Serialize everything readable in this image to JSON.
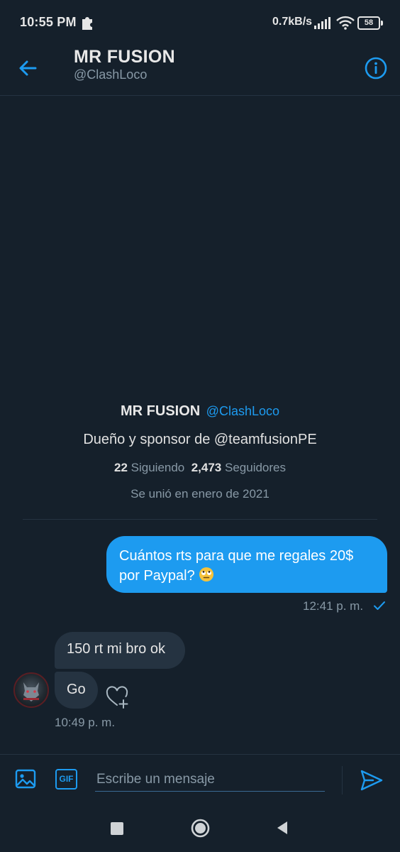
{
  "status_bar": {
    "time": "10:55 PM",
    "speed": "0.7kB/s",
    "battery": "58",
    "icons": [
      "puzzle-icon",
      "signal-icon",
      "wifi-icon",
      "battery-icon"
    ]
  },
  "header": {
    "title": "MR FUSION",
    "handle": "@ClashLoco",
    "back_icon": "arrow-left-icon",
    "info_icon": "info-icon"
  },
  "profile": {
    "name": "MR FUSION",
    "handle": "@ClashLoco",
    "bio": "Dueño y sponsor de @teamfusionPE",
    "following_count": "22",
    "following_label": "Siguiendo",
    "followers_count": "2,473",
    "followers_label": "Seguidores",
    "joined": "Se unió en enero de 2021"
  },
  "messages": {
    "sent": {
      "text": "Cuántos rts para que me regales 20$ por Paypal?",
      "emoji": "rolling-eyes-emoji",
      "time": "12:41 p. m."
    },
    "received": [
      {
        "text": "150 rt mi bro ok"
      },
      {
        "text": "Go"
      }
    ],
    "received_time": "10:49 p. m."
  },
  "composer": {
    "gif_label": "GIF",
    "placeholder": "Escribe un mensaje"
  },
  "colors": {
    "background": "#15202b",
    "accent": "#1d9bf0",
    "bubble_received": "#253341",
    "muted_text": "#8899a6"
  }
}
